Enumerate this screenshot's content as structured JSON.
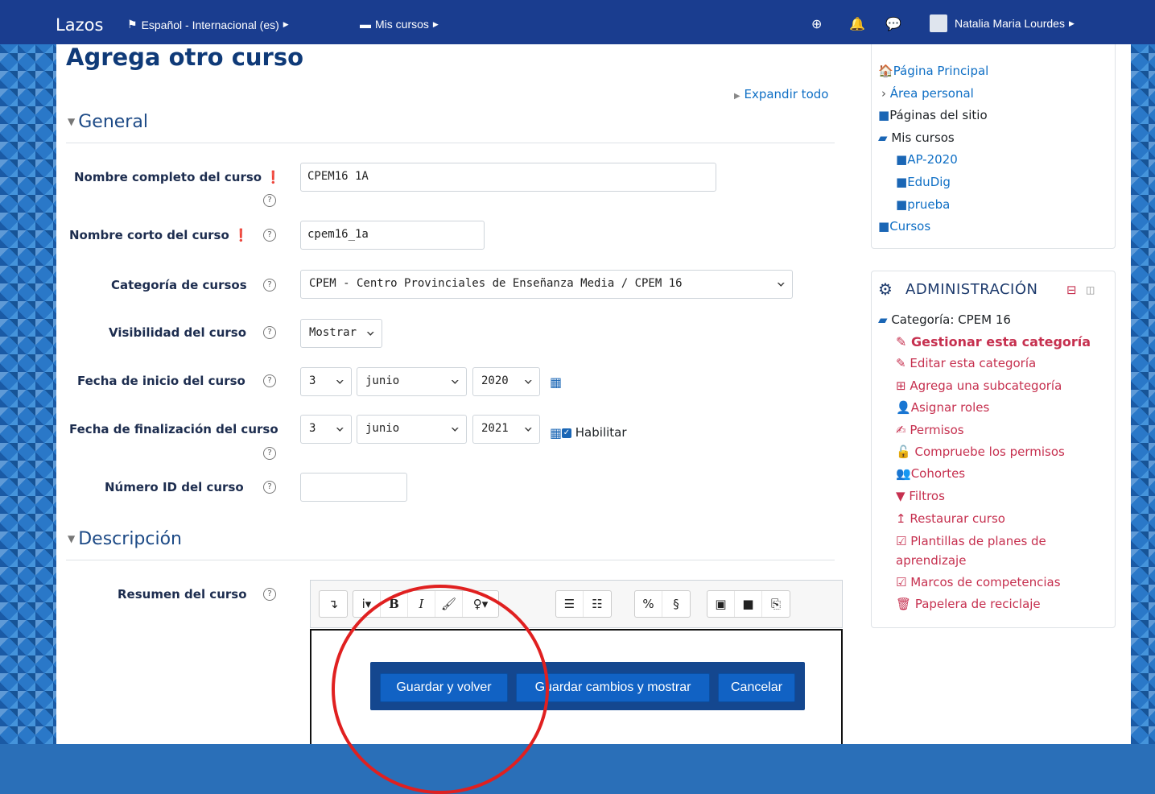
{
  "navbar": {
    "brand": "Lazos",
    "language": "Español - Internacional (es)",
    "my_courses": "Mis cursos",
    "user_name": "Natalia Maria Lourdes"
  },
  "page": {
    "title": "Agrega otro curso",
    "expand_all": "Expandir todo"
  },
  "sections": {
    "general": "General",
    "description": "Descripción"
  },
  "form": {
    "full_name_label": "Nombre completo del curso",
    "full_name_value": "CPEM16 1A",
    "short_name_label": "Nombre corto del curso",
    "short_name_value": "cpem16_1a",
    "category_label": "Categoría de cursos",
    "category_value": "CPEM - Centro Provinciales de Enseñanza Media / CPEM 16",
    "visibility_label": "Visibilidad del curso",
    "visibility_value": "Mostrar",
    "start_label": "Fecha de inicio del curso",
    "start_day": "3",
    "start_month": "junio",
    "start_year": "2020",
    "end_label": "Fecha de finalización del curso",
    "end_day": "3",
    "end_month": "junio",
    "end_year": "2021",
    "enable_label": "Habilitar",
    "id_label": "Número ID del curso",
    "id_value": "",
    "summary_label": "Resumen del curso"
  },
  "buttons": {
    "save_return": "Guardar y volver",
    "save_display": "Guardar cambios y mostrar",
    "cancel": "Cancelar"
  },
  "navigation_block": {
    "items": {
      "home": "Página Principal",
      "dashboard": "Área personal",
      "site_pages": "Páginas del sitio",
      "my_courses": "Mis cursos",
      "c1": "AP-2020",
      "c2": "EduDig",
      "c3": "prueba",
      "courses": "Cursos"
    }
  },
  "admin_block": {
    "title": "ADMINISTRACIÓN",
    "category": "Categoría: CPEM 16",
    "manage": "Gestionar esta categoría",
    "edit": "Editar esta categoría",
    "add_sub": "Agrega una subcategoría",
    "assign_roles": "Asignar roles",
    "permissions": "Permisos",
    "check_perms": "Compruebe los permisos",
    "cohorts": "Cohortes",
    "filters": "Filtros",
    "restore": "Restaurar curso",
    "templates_1": "Plantillas de planes de",
    "templates_2": "aprendizaje",
    "frameworks": "Marcos de competencias",
    "recycle": "Papelera de reciclaje"
  }
}
